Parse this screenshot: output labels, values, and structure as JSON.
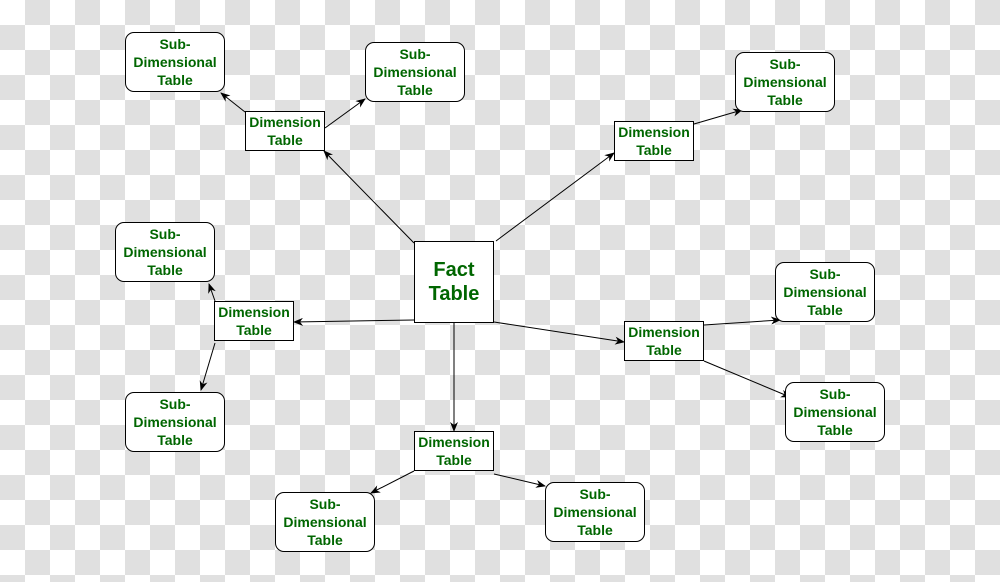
{
  "colors": {
    "text": "#006600",
    "border": "#000000"
  },
  "nodes": [
    {
      "id": "fact",
      "kind": "fact",
      "label": "Fact\nTable"
    },
    {
      "id": "d1",
      "kind": "dim",
      "label": "Dimension\nTable"
    },
    {
      "id": "d2",
      "kind": "dim",
      "label": "Dimension\nTable"
    },
    {
      "id": "d3",
      "kind": "dim",
      "label": "Dimension\nTable"
    },
    {
      "id": "d4",
      "kind": "dim",
      "label": "Dimension\nTable"
    },
    {
      "id": "d5",
      "kind": "dim",
      "label": "Dimension\nTable"
    },
    {
      "id": "s1",
      "kind": "sub",
      "label": "Sub-\nDimensional\nTable"
    },
    {
      "id": "s2",
      "kind": "sub",
      "label": "Sub-\nDimensional\nTable"
    },
    {
      "id": "s3",
      "kind": "sub",
      "label": "Sub-\nDimensional\nTable"
    },
    {
      "id": "s4",
      "kind": "sub",
      "label": "Sub-\nDimensional\nTable"
    },
    {
      "id": "s5",
      "kind": "sub",
      "label": "Sub-\nDimensional\nTable"
    },
    {
      "id": "s6",
      "kind": "sub",
      "label": "Sub-\nDimensional\nTable"
    },
    {
      "id": "s7",
      "kind": "sub",
      "label": "Sub-\nDimensional\nTable"
    },
    {
      "id": "s8",
      "kind": "sub",
      "label": "Sub-\nDimensional\nTable"
    },
    {
      "id": "s9",
      "kind": "sub",
      "label": "Sub-\nDimensional\nTable"
    }
  ],
  "edges": [
    {
      "from": "fact",
      "to": "d1"
    },
    {
      "from": "fact",
      "to": "d2"
    },
    {
      "from": "fact",
      "to": "d3"
    },
    {
      "from": "fact",
      "to": "d4"
    },
    {
      "from": "fact",
      "to": "d5"
    },
    {
      "from": "d1",
      "to": "s1"
    },
    {
      "from": "d1",
      "to": "s2"
    },
    {
      "from": "d2",
      "to": "s3"
    },
    {
      "from": "d3",
      "to": "s4"
    },
    {
      "from": "d3",
      "to": "s5"
    },
    {
      "from": "d4",
      "to": "s6"
    },
    {
      "from": "d4",
      "to": "s7"
    },
    {
      "from": "d5",
      "to": "s8"
    },
    {
      "from": "d5",
      "to": "s9"
    }
  ]
}
